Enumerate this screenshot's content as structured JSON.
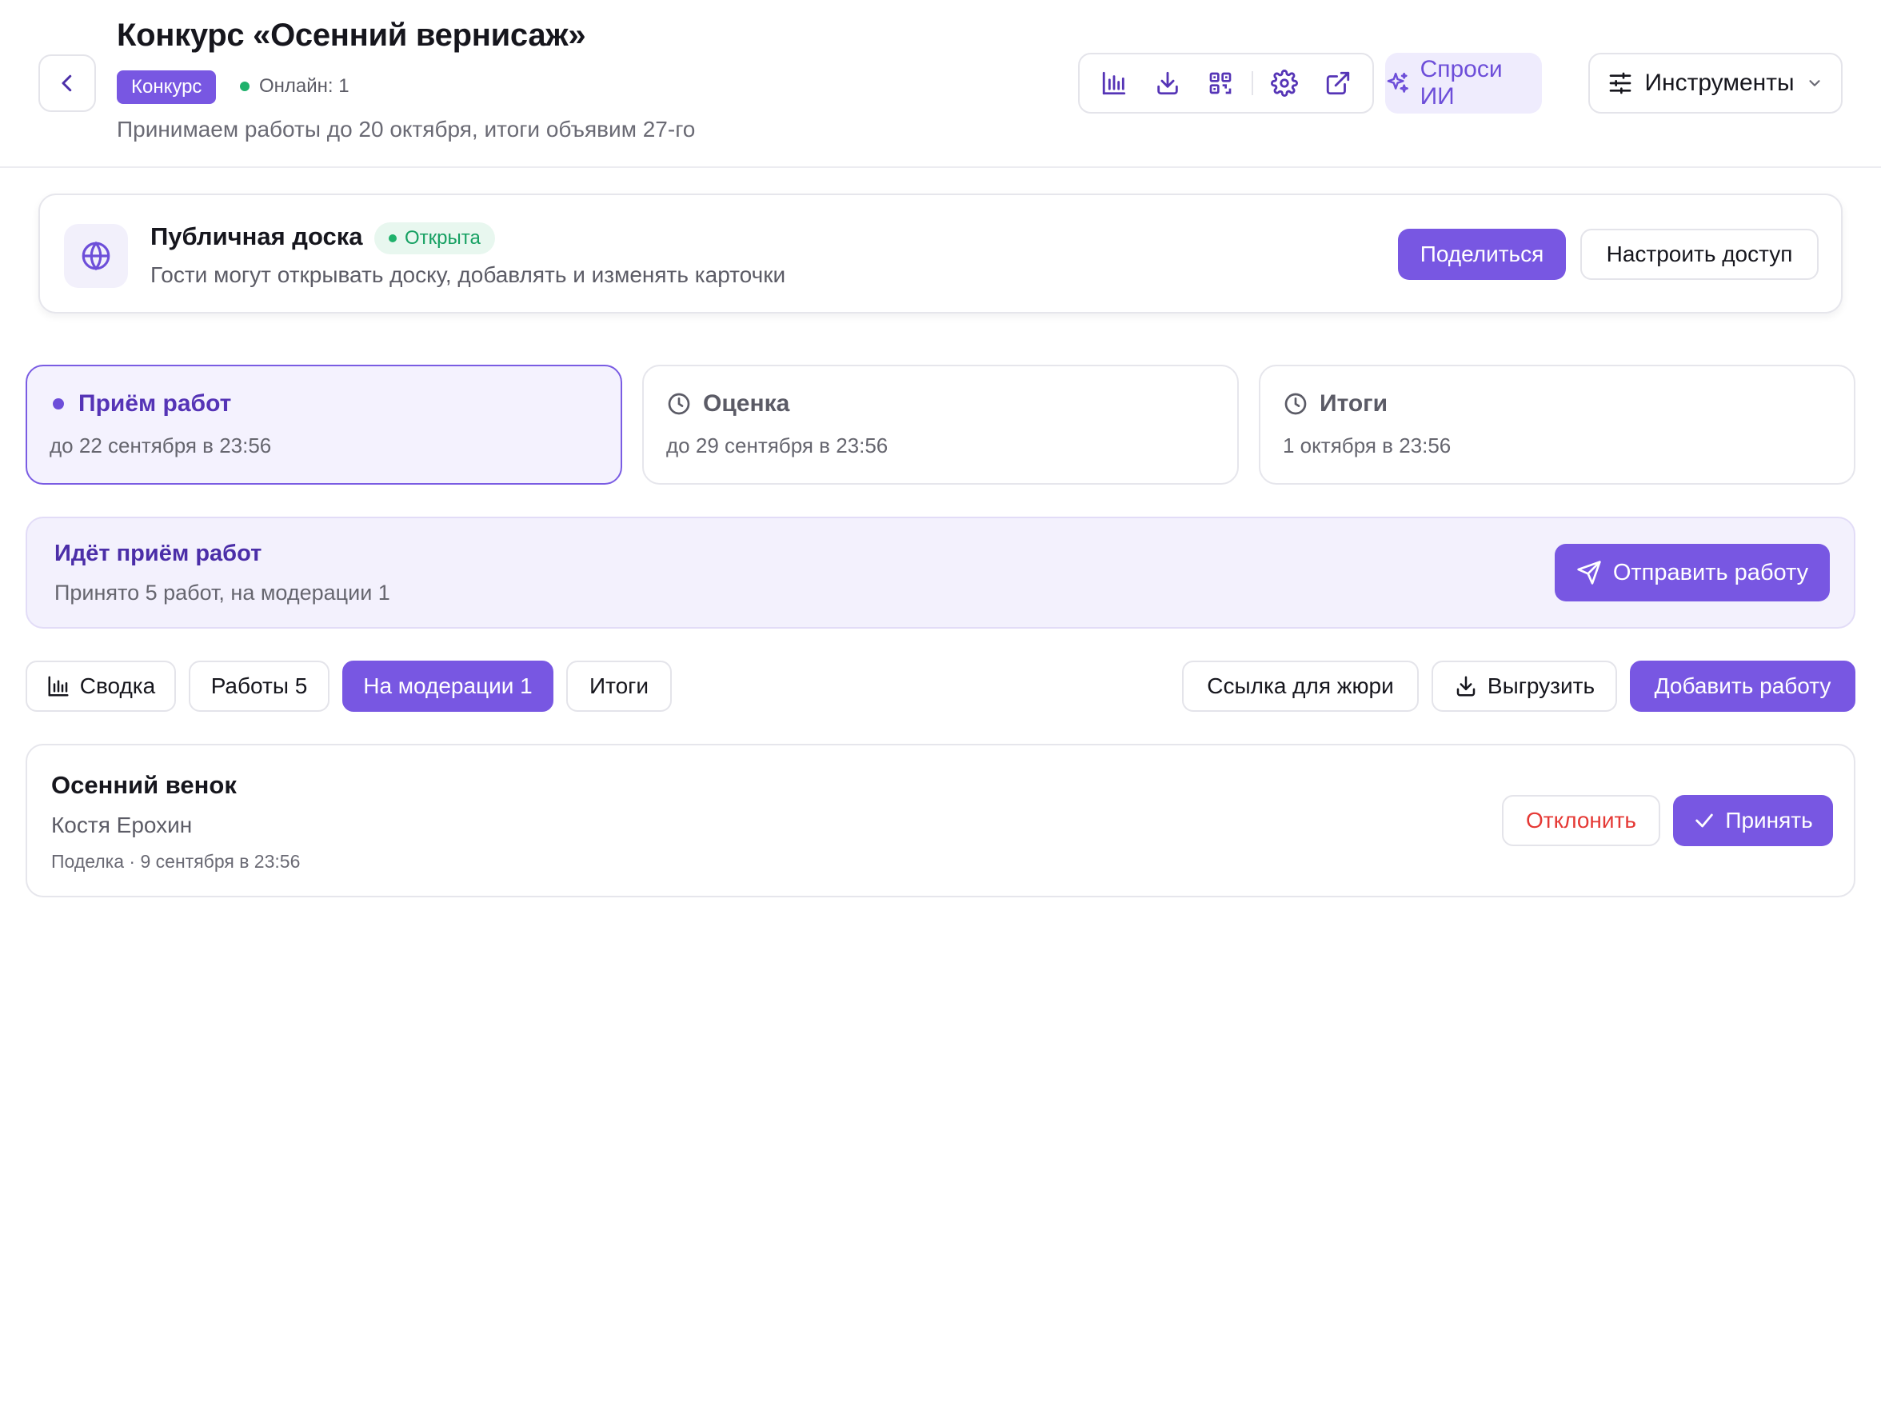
{
  "header": {
    "title": "Конкурс «Осенний вернисаж»",
    "badge": "Конкурс",
    "online": "Онлайн: 1",
    "subtitle": "Принимаем работы до 20 октября, итоги объявим 27-го",
    "toolbar_icons": [
      "bar-chart-icon",
      "download-icon",
      "qr-code-icon",
      "gear-icon",
      "external-link-icon"
    ],
    "ask_ai": "Спроси ИИ",
    "tools": "Инструменты"
  },
  "board": {
    "title": "Публичная доска",
    "status": "Открыта",
    "description": "Гости могут открывать доску, добавлять и изменять карточки",
    "share": "Поделиться",
    "access": "Настроить доступ"
  },
  "stages": [
    {
      "label": "Приём работ",
      "date": "до 22 сентября в 23:56",
      "active": true
    },
    {
      "label": "Оценка",
      "date": "до 29 сентября в 23:56",
      "active": false
    },
    {
      "label": "Итоги",
      "date": "1 октября в 23:56",
      "active": false
    }
  ],
  "banner": {
    "title": "Идёт приём работ",
    "description": "Принято 5 работ, на модерации 1",
    "submit": "Отправить работу"
  },
  "tabs": {
    "summary": "Сводка",
    "works": "Работы 5",
    "moderation": "На модерации 1",
    "results": "Итоги",
    "jury_link": "Ссылка для жюри",
    "export": "Выгрузить",
    "add_work": "Добавить работу"
  },
  "submission": {
    "title": "Осенний венок",
    "author": "Костя Ерохин",
    "meta": "Поделка · 9 сентября в 23:56",
    "reject": "Отклонить",
    "accept": "Принять"
  },
  "colors": {
    "accent": "#7857e2",
    "accent_light": "#f3f1fd",
    "success": "#1fb16b",
    "danger": "#e53935"
  }
}
